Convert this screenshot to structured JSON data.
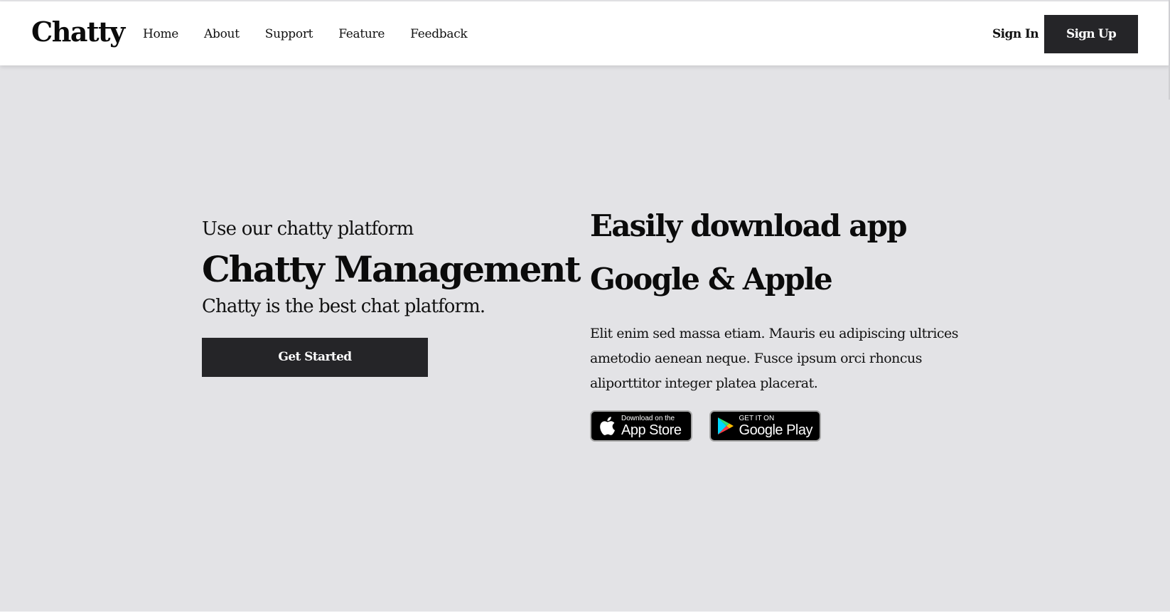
{
  "nav": {
    "brand": "Chatty",
    "links": [
      "Home",
      "About",
      "Support",
      "Feature",
      "Feedback"
    ],
    "signin_label": "Sign In",
    "signup_label": "Sign Up"
  },
  "hero": {
    "eyebrow": "Use our chatty platform",
    "title": "Chatty Management",
    "subtitle": "Chatty is the best chat platform.",
    "cta_label": "Get Started"
  },
  "download": {
    "title_line1": "Easily download app",
    "title_line2": "Google & Apple",
    "body": "Elit enim sed massa etiam. Mauris eu adipiscing ultrices ametodio aenean neque. Fusce ipsum orci rhoncus aliporttitor integer platea placerat.",
    "app_store": {
      "small": "Download on the",
      "big": "App Store",
      "icon": "apple-icon"
    },
    "google_play": {
      "small": "GET IT ON",
      "big": "Google Play",
      "icon": "google-play-icon"
    }
  },
  "colors": {
    "dark_button": "#252528",
    "hero_background": "#e3e3e6",
    "nav_background": "#ffffff"
  }
}
